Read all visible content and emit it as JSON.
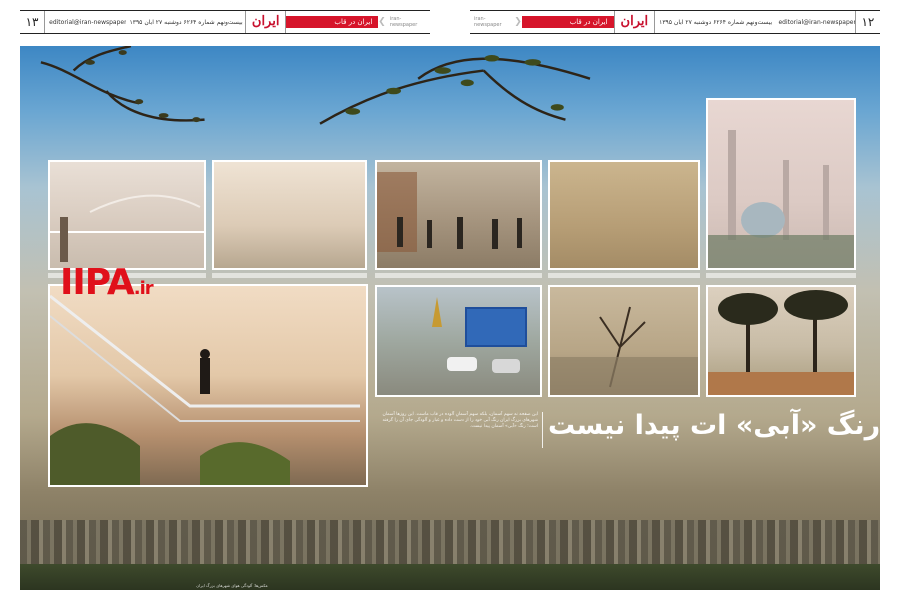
{
  "header_left": {
    "page_number": "۱۳",
    "email": "editorial@iran-newspaper.com",
    "date_line": "سال بیست‌ونهم شماره ۶۲۶۴ دوشنبه ۲۷ آبان ۱۳۹۵",
    "logo": "ایران",
    "section": "ایران در قاب",
    "website": "iran-newspaper"
  },
  "header_right": {
    "page_number": "۱۲",
    "email": "editorial@iran-newspaper.com",
    "date_line": "سال بیست‌ونهم شماره ۶۲۶۴ دوشنبه ۲۷ آبان ۱۳۹۵",
    "logo": "ایران",
    "section": "ایران در قاب",
    "website": "iran-newspaper"
  },
  "watermark": {
    "main": "IIPA",
    "suffix": ".ir"
  },
  "article": {
    "headline": "رنگ «آبی» ات پیدا نیست",
    "intro": "این صفحه نه سهم آسمان، بلکه سهم آسمانِ آلوده در قاب ماست. این روزها آسمان شهرهای بزرگ ایران رنگ آبی خود را از دست داده و غبار و آلودگی جای آن را گرفته است؛ رنگ «آبی» آسمان پیدا نیست."
  },
  "footer_caption": "عکس‌ها: آلودگی هوای شهرهای بزرگ ایران"
}
